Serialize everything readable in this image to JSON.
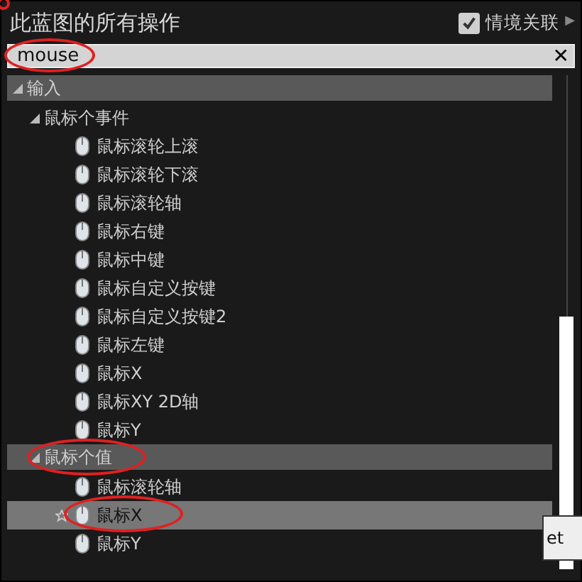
{
  "title": "此蓝图的所有操作",
  "context_toggle": {
    "label": "情境关联",
    "checked": true,
    "arrow": "▶"
  },
  "search": {
    "value": "mouse",
    "circled": true,
    "clear": "✕"
  },
  "corner_mark": true,
  "tree": [
    {
      "label": "输入",
      "kind": "category",
      "expanded": true,
      "circled": false,
      "children": [
        {
          "label": "鼠标个事件",
          "kind": "group",
          "expanded": true,
          "circled": false,
          "children": [
            {
              "label": "鼠标滚轮上滚",
              "kind": "action",
              "selected": false,
              "circled": false
            },
            {
              "label": "鼠标滚轮下滚",
              "kind": "action",
              "selected": false,
              "circled": false
            },
            {
              "label": "鼠标滚轮轴",
              "kind": "action",
              "selected": false,
              "circled": false
            },
            {
              "label": "鼠标右键",
              "kind": "action",
              "selected": false,
              "circled": false
            },
            {
              "label": "鼠标中键",
              "kind": "action",
              "selected": false,
              "circled": false
            },
            {
              "label": "鼠标自定义按键",
              "kind": "action",
              "selected": false,
              "circled": false
            },
            {
              "label": "鼠标自定义按键2",
              "kind": "action",
              "selected": false,
              "circled": false
            },
            {
              "label": "鼠标左键",
              "kind": "action",
              "selected": false,
              "circled": false
            },
            {
              "label": "鼠标X",
              "kind": "action",
              "selected": false,
              "circled": false
            },
            {
              "label": "鼠标XY 2D轴",
              "kind": "action",
              "selected": false,
              "circled": false
            },
            {
              "label": "鼠标Y",
              "kind": "action",
              "selected": false,
              "circled": false
            }
          ]
        },
        {
          "label": "鼠标个值",
          "kind": "category",
          "expanded": true,
          "circled": true,
          "children": [
            {
              "label": "鼠标滚轮轴",
              "kind": "action",
              "selected": false,
              "circled": false
            },
            {
              "label": "鼠标X",
              "kind": "action",
              "selected": true,
              "circled": true
            },
            {
              "label": "鼠标Y",
              "kind": "action",
              "selected": false,
              "circled": false
            }
          ]
        }
      ]
    }
  ],
  "tooltip": {
    "text": "et"
  }
}
